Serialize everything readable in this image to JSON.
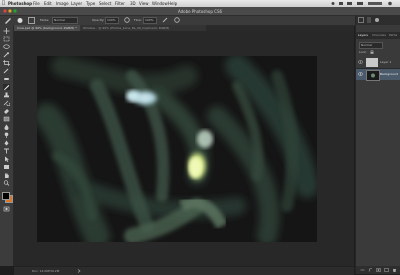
{
  "menubar": {
    "apple_icon": "apple-icon",
    "items": [
      "Photoshop",
      "File",
      "Edit",
      "Image",
      "Layer",
      "Type",
      "Select",
      "Filter",
      "3D",
      "View",
      "Window",
      "Help"
    ]
  },
  "window": {
    "title": "Adobe Photoshop CS6"
  },
  "options": {
    "mode_label": "Mode:",
    "mode_value": "Normal",
    "opacity_label": "Opacity:",
    "opacity_value": "100%",
    "flow_label": "Flow:",
    "flow_value": "100%"
  },
  "tabs": [
    {
      "label": "Cure.psd @ 99% (background, RGB/8) *"
    },
    {
      "label": "Window...  @ 99% (Photos_bona_8a_99_Cupboard, RGB/8)"
    }
  ],
  "panels": {
    "tab_layers": "Layers",
    "tab_channels": "Channels",
    "tab_paths": "Paths",
    "blend_mode": "Normal",
    "lock_label": "Lock:",
    "layers": [
      {
        "name": "Layer 1"
      },
      {
        "name": "Background"
      }
    ]
  },
  "status": {
    "doc": "Doc: 14.0M/39.2M"
  },
  "colors": {
    "fg": "#000000",
    "bg": "#d9772c",
    "ui_dark": "#3a3a3a",
    "canvas_bg": "#141414",
    "stroke_green": "#3b5244",
    "highlight": "#e8f2a0",
    "highlight_blue": "#b8dbe4"
  }
}
